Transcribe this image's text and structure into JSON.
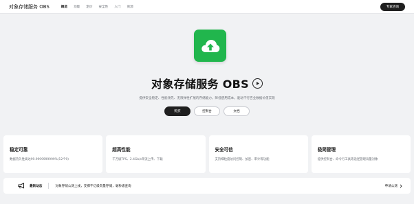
{
  "header": {
    "brand": "对象存储服务 OBS",
    "tabs": [
      {
        "label": "概览",
        "active": true
      },
      {
        "label": "功能",
        "active": false
      },
      {
        "label": "定价",
        "active": false
      },
      {
        "label": "安全性",
        "active": false
      },
      {
        "label": "入门",
        "active": false
      },
      {
        "label": "资源",
        "active": false
      }
    ],
    "consult_label": "专家咨询"
  },
  "hero": {
    "icon": "cloud-upload-icon",
    "title": "对象存储服务 OBS",
    "description": "提供安全稳定、性能领先、无限弹性扩展的存储能力，降低使用成本，驱动千行百业数据价值实现",
    "buttons": {
      "buy": "购买",
      "console": "控制台",
      "docs": "文档"
    }
  },
  "features": [
    {
      "title": "稳定可靠",
      "desc": "数据持久性高达99.9999999999%(12个9)"
    },
    {
      "title": "超高性能",
      "desc": "千万级TPS、2.4Gb/s单流上传、下载"
    },
    {
      "title": "安全可信",
      "desc": "支持细粒度访问控制、加密、审计等功能"
    },
    {
      "title": "极简管理",
      "desc": "提供控制台、命令行工具等途径管理海量对象"
    }
  ],
  "news": {
    "label": "最新动态",
    "text": "对象存储公测上线，支撑千亿级向量存储，毫秒级查询",
    "link": "申请公测"
  },
  "colors": {
    "accent_green": "#21b64d",
    "dark": "#1f1f1f",
    "background": "#f1f2f4"
  }
}
